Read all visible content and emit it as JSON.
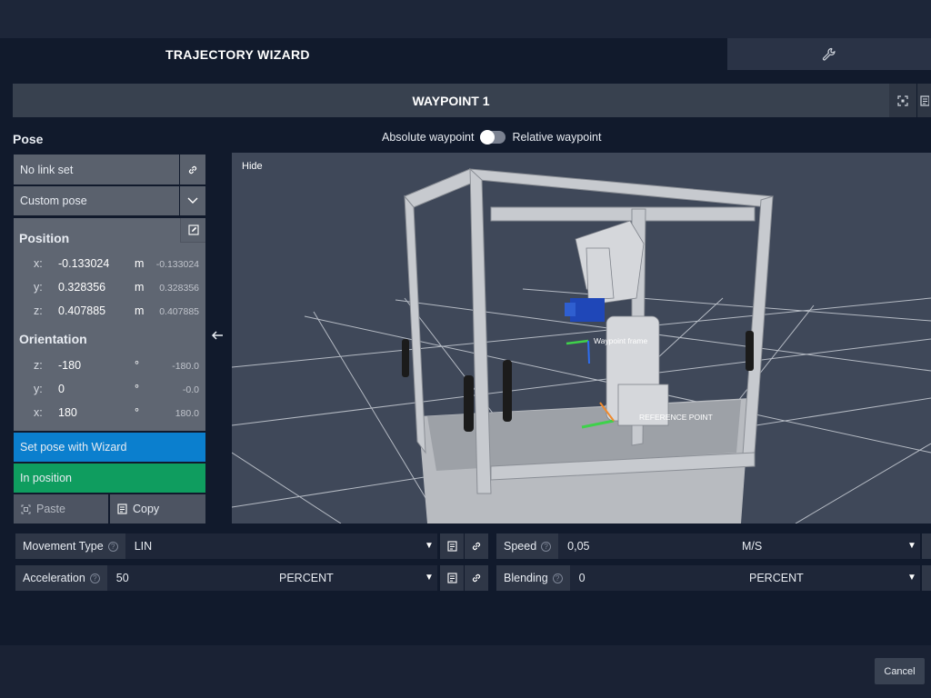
{
  "header": {
    "title": "TRAJECTORY WIZARD",
    "tools_icon": "wrench-icon"
  },
  "waypoint": {
    "title": "WAYPOINT 1",
    "icons": [
      "fit-view-icon",
      "notes-icon"
    ]
  },
  "pose": {
    "label": "Pose",
    "toggle_left": "Absolute waypoint",
    "toggle_right": "Relative waypoint",
    "toggle_state": "absolute"
  },
  "left_panel": {
    "link": "No link set",
    "pose_type": "Custom pose",
    "position": {
      "title": "Position",
      "rows": [
        {
          "axis": "x:",
          "value": "-0.133024",
          "unit": "m",
          "sub": "-0.133024"
        },
        {
          "axis": "y:",
          "value": "0.328356",
          "unit": "m",
          "sub": "0.328356"
        },
        {
          "axis": "z:",
          "value": "0.407885",
          "unit": "m",
          "sub": "0.407885"
        }
      ]
    },
    "orientation": {
      "title": "Orientation",
      "rows": [
        {
          "axis": "z:",
          "value": "-180",
          "unit": "°",
          "sub": "-180.0"
        },
        {
          "axis": "y:",
          "value": "0",
          "unit": "°",
          "sub": "-0.0"
        },
        {
          "axis": "x:",
          "value": "180",
          "unit": "°",
          "sub": "180.0"
        }
      ]
    },
    "set_pose_button": "Set pose with Wizard",
    "in_position_button": "In position",
    "paste_button": "Paste",
    "copy_button": "Copy"
  },
  "viewport": {
    "hide_label": "Hide",
    "waypoint_label": "Waypoint frame",
    "reference_label": "REFERENCE POINT"
  },
  "params": {
    "movement_type": {
      "label": "Movement Type",
      "value": "LIN"
    },
    "speed": {
      "label": "Speed",
      "value": "0,05",
      "unit": "M/S"
    },
    "acceleration": {
      "label": "Acceleration",
      "value": "50",
      "unit": "PERCENT"
    },
    "blending": {
      "label": "Blending",
      "value": "0",
      "unit": "PERCENT"
    }
  },
  "footer": {
    "cancel": "Cancel"
  },
  "colors": {
    "accent_blue": "#0b7fce",
    "accent_green": "#0f9d5f",
    "background": "#111a2c"
  }
}
